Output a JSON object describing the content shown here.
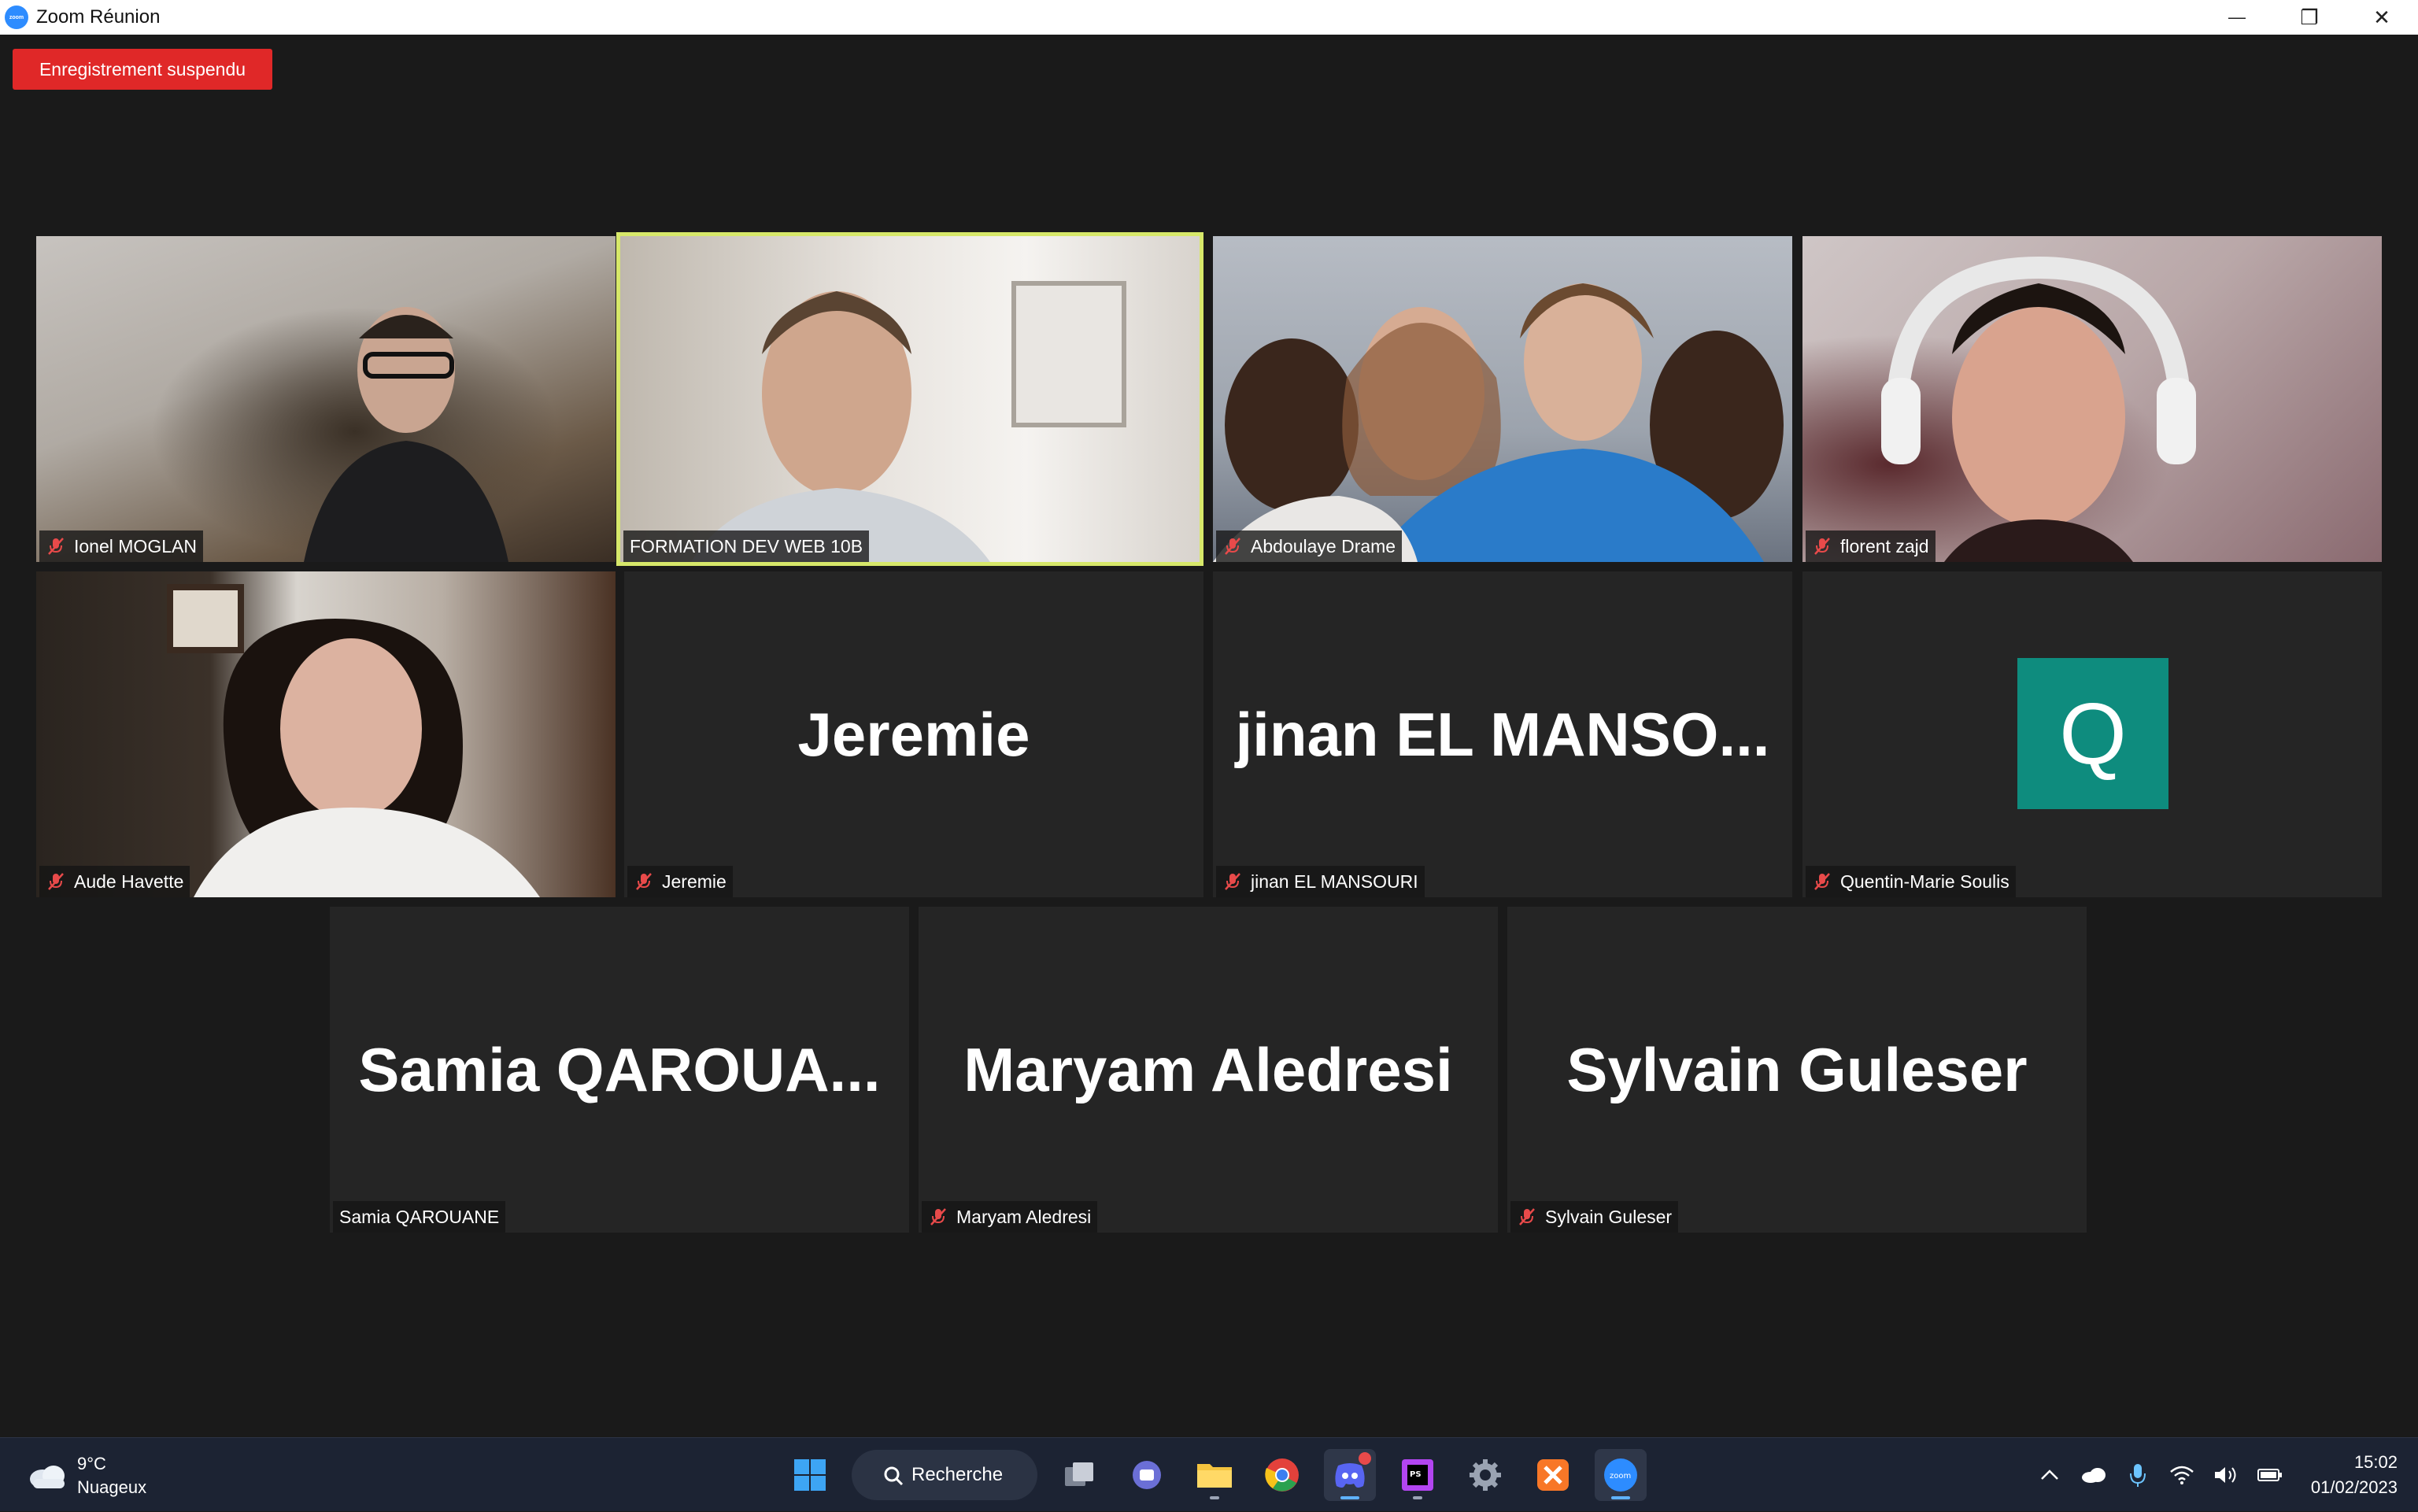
{
  "window": {
    "title": "Zoom Réunion",
    "app_icon_text": "zoom",
    "minimize_glyph": "—",
    "restore_glyph": "❐",
    "close_glyph": "✕"
  },
  "recording": {
    "label": "Enregistrement suspendu",
    "color": "#e02828"
  },
  "participants": [
    {
      "name": "Ionel MOGLAN",
      "video": true,
      "muted": true
    },
    {
      "name": "FORMATION DEV WEB 10B",
      "video": true,
      "muted": false,
      "active_speaker": true
    },
    {
      "name": "Abdoulaye Drame",
      "video": true,
      "muted": true
    },
    {
      "name": "florent zajd",
      "video": true,
      "muted": true
    },
    {
      "name": "Aude Havette",
      "video": true,
      "muted": true
    },
    {
      "name": "Jeremie",
      "display": "Jeremie",
      "video": false,
      "muted": true
    },
    {
      "name": "jinan EL MANSOURI",
      "display": "jinan  EL  MANSO...",
      "video": false,
      "muted": true
    },
    {
      "name": "Quentin-Marie Soulis",
      "avatar_letter": "Q",
      "video": false,
      "muted": true
    },
    {
      "name": "Samia QAROUANE",
      "display": "Samia  QAROUA...",
      "video": false,
      "muted": false
    },
    {
      "name": "Maryam Aledresi",
      "display": "Maryam Aledresi",
      "video": false,
      "muted": true
    },
    {
      "name": "Sylvain Guleser",
      "display": "Sylvain Guleser",
      "video": false,
      "muted": true
    }
  ],
  "taskbar": {
    "weather": {
      "temp": "9°C",
      "desc": "Nuageux"
    },
    "search_label": "Recherche",
    "apps": [
      "windows-start",
      "search",
      "task-view",
      "teams-chat",
      "file-explorer",
      "chrome",
      "discord",
      "phpstorm",
      "settings",
      "xampp",
      "zoom"
    ],
    "clock": {
      "time": "15:02",
      "date": "01/02/2023"
    }
  },
  "colors": {
    "active_speaker_border": "#d7e86a",
    "avatar_bg": "#0e8c7e",
    "taskbar_bg": "#1c2333"
  }
}
